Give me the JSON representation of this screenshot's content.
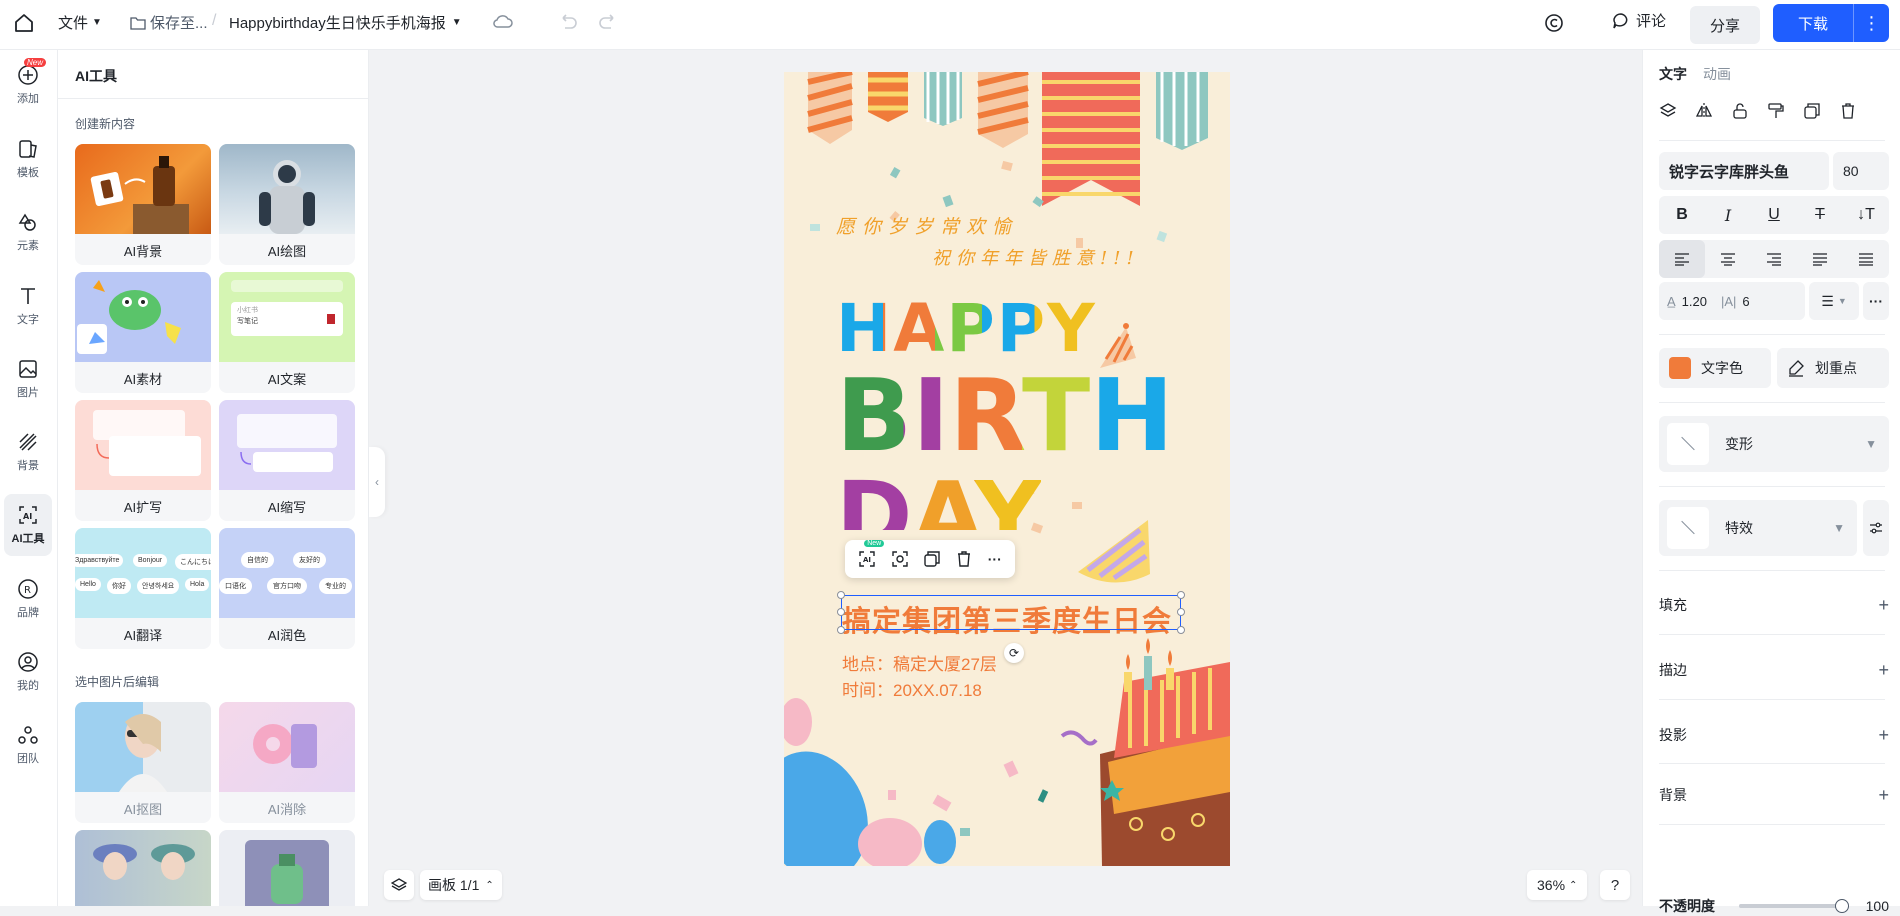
{
  "topbar": {
    "file_label": "文件",
    "save_label": "保存至...",
    "separator": "/",
    "doc_title": "Happybirthday生日快乐手机海报",
    "comment_label": "评论",
    "share_label": "分享",
    "download_label": "下载",
    "more_glyph": "⋮"
  },
  "leftnav": {
    "items": [
      {
        "label": "添加",
        "icon": "plus-circle-icon",
        "badge": "New"
      },
      {
        "label": "模板",
        "icon": "template-icon"
      },
      {
        "label": "元素",
        "icon": "shapes-icon"
      },
      {
        "label": "文字",
        "icon": "text-icon"
      },
      {
        "label": "图片",
        "icon": "image-icon"
      },
      {
        "label": "背景",
        "icon": "background-icon"
      },
      {
        "label": "AI工具",
        "icon": "ai-icon",
        "active": true
      },
      {
        "label": "品牌",
        "icon": "brand-icon"
      },
      {
        "label": "我的",
        "icon": "user-icon"
      },
      {
        "label": "团队",
        "icon": "team-icon"
      }
    ]
  },
  "panel": {
    "title": "AI工具",
    "section_create": "创建新内容",
    "section_edit": "选中图片后编辑",
    "create_cards": [
      {
        "label": "AI背景"
      },
      {
        "label": "AI绘图"
      },
      {
        "label": "AI素材"
      },
      {
        "label": "AI文案"
      },
      {
        "label": "AI扩写"
      },
      {
        "label": "AI缩写"
      },
      {
        "label": "AI翻译"
      },
      {
        "label": "AI润色"
      }
    ],
    "edit_cards": [
      {
        "label": "AI抠图"
      },
      {
        "label": "AI消除"
      }
    ],
    "thumb_texts": {
      "wenan_top": "写笔记",
      "wenan_small": "小红书",
      "translate_words": [
        "Здравствуйте",
        "Bonjour",
        "こんにちは",
        "Hello",
        "你好",
        "안녕하세요",
        "Hola"
      ],
      "polish_words": [
        "自信的",
        "友好的",
        "口语化",
        "官方口吻",
        "专业的"
      ]
    }
  },
  "poster": {
    "wish_line1": "愿你岁岁常欢愉",
    "wish_line2": "祝你年年皆胜意!!!",
    "happy": "HAPPY",
    "birth": "BIRTH",
    "day": "DAY",
    "headline": "搞定集团第三季度生日会",
    "location": "地点：稿定大厦27层",
    "time": "时间：20XX.07.18"
  },
  "selection_toolbar": {
    "new_badge": "New",
    "more_glyph": "···"
  },
  "bottom": {
    "artboard_label": "画板 1/1",
    "zoom": "36%",
    "help": "?"
  },
  "rpanel": {
    "tab_text": "文字",
    "tab_animation": "动画",
    "font_name": "锐字云字库胖头鱼",
    "font_size": "80",
    "line_height": "1.20",
    "letter_spacing": "6",
    "text_color_label": "文字色",
    "text_color": "#f07b3a",
    "highlight_label": "划重点",
    "transform_label": "变形",
    "effects_label": "特效",
    "fill_label": "填充",
    "stroke_label": "描边",
    "shadow_label": "投影",
    "background_label": "背景",
    "opacity_label": "不透明度",
    "opacity_value": "100",
    "opacity_fraction": 1.0
  },
  "colors": {
    "accent": "#1f5eff",
    "poster_bg": "#f9eed9",
    "headline": "#f07b3a"
  }
}
